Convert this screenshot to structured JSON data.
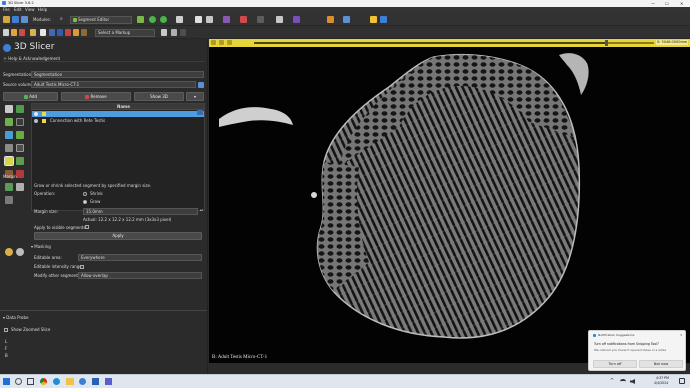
{
  "window": {
    "title": "3D Slicer 5.6.2"
  },
  "menu": [
    "File",
    "Edit",
    "View",
    "Help"
  ],
  "toolbar": {
    "modules_label": "Modules:",
    "module_selected": "Segment Editor",
    "markup_selected": "Select a Markup"
  },
  "brand": {
    "name": "3D Slicer"
  },
  "help": {
    "label": "Help & Acknowledgement"
  },
  "segment_editor": {
    "segmentation_label": "Segmentation:",
    "segmentation_value": "Segmentation",
    "source_label": "Source volume:",
    "source_value": "Adult Testis Micro-CT-1",
    "add_label": "Add",
    "remove_label": "Remove",
    "show3d_label": "Show 3D",
    "table_header": "Name",
    "segments": [
      {
        "name": "",
        "color": "#f1d64b",
        "selected": true
      },
      {
        "name": "Connection with Rete Testis",
        "color": "#f1d64b",
        "selected": false
      }
    ]
  },
  "margin": {
    "title": "Margin",
    "description": "Grow or shrink selected segment by specified margin size.",
    "operation_label": "Operation:",
    "shrink_label": "Shrink",
    "grow_label": "Grow",
    "operation_selected": "Grow",
    "margin_size_label": "Margin size:",
    "margin_size_value": "15.0mm",
    "actual_label": "Actual: 12.2 x 12.2 x 12.2 mm (3x3x3 pixel)",
    "apply_visible_label": "Apply to visible segments:",
    "apply_label": "Apply"
  },
  "masking": {
    "title": "Masking",
    "editable_area_label": "Editable area:",
    "editable_area_value": "Everywhere",
    "intensity_label": "Editable intensity range:",
    "modify_label": "Modify other segments:",
    "modify_value": "Allow overlap"
  },
  "data_probe": {
    "title": "Data Probe",
    "show_zoomed": "Show Zoomed Slice",
    "rows": [
      "L",
      "F",
      "B"
    ]
  },
  "viewer": {
    "slice_value": "S: 5046.0000mm",
    "volume_label": "B: Adult Testis Micro-CT-1",
    "slider_fraction": 0.88
  },
  "notification": {
    "app": "Notification Suggestions",
    "title": "Turn off notifications from Snipping Tool?",
    "body": "We noticed you haven't opened these in a while",
    "turn_off": "Turn off",
    "not_now": "Not now"
  },
  "taskbar": {
    "time": "4:37 PM",
    "date": "4/4/2024"
  },
  "colors": {
    "accent": "#3d7fd6",
    "slider_bar": "#e5d43a",
    "selection": "#4d9de0"
  }
}
